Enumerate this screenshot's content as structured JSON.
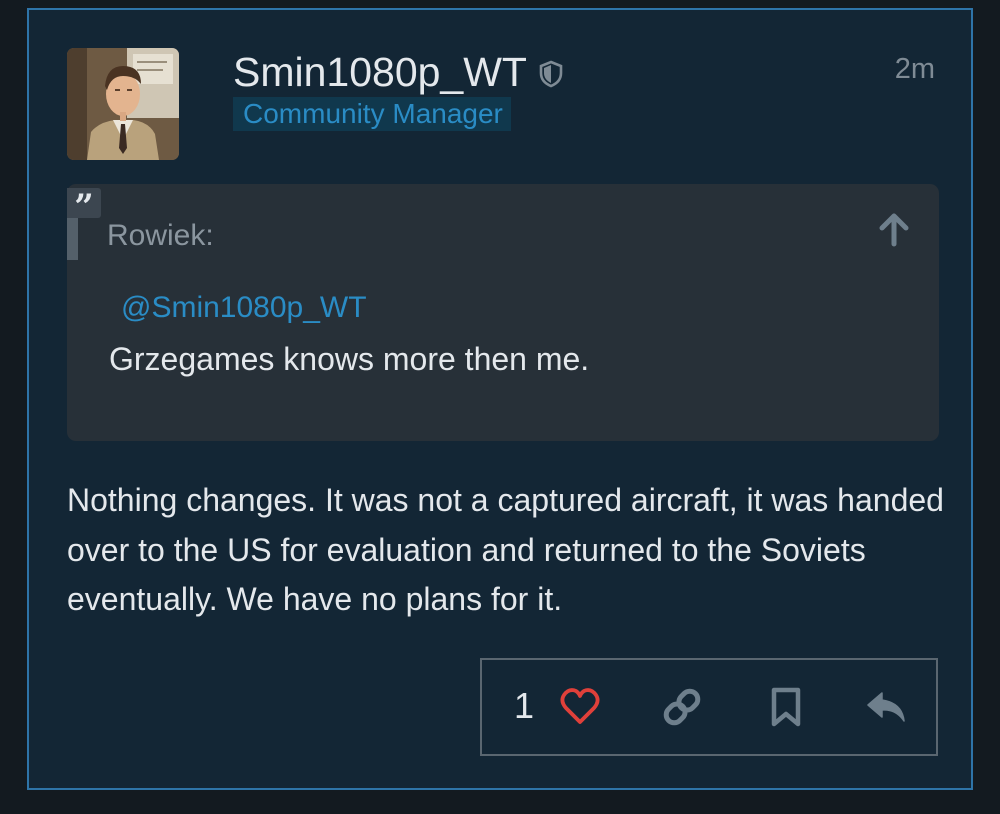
{
  "post": {
    "username": "Smin1080p_WT",
    "role_badge": "Community Manager",
    "timestamp": "2m",
    "icons": {
      "avatar": "portrait-avatar",
      "moderator": "shield-icon"
    },
    "quote": {
      "author": "Rowiek:",
      "mention": "@Smin1080p_WT",
      "text": "Grzegames knows more then me.",
      "quote_mark": "”",
      "icons": [
        "quote-icon",
        "arrow-up-icon"
      ]
    },
    "body": "Nothing changes. It was not a captured aircraft, it was handed over to the US for evaluation and returned to the Soviets eventually. We have no plans for it.",
    "actions": {
      "like_count": "1",
      "icons": [
        "heart-icon",
        "link-icon",
        "bookmark-icon",
        "reply-icon"
      ]
    }
  },
  "colors": {
    "background": "#131a20",
    "post_background": "#132635",
    "post_border": "#2e74a8",
    "accent_blue": "#2a8cc5",
    "quote_background": "#273038",
    "like_red": "#e0403a",
    "icon_gray": "#6e7f8c",
    "text": "#e4e8ec",
    "muted_text": "#7f8b95"
  }
}
